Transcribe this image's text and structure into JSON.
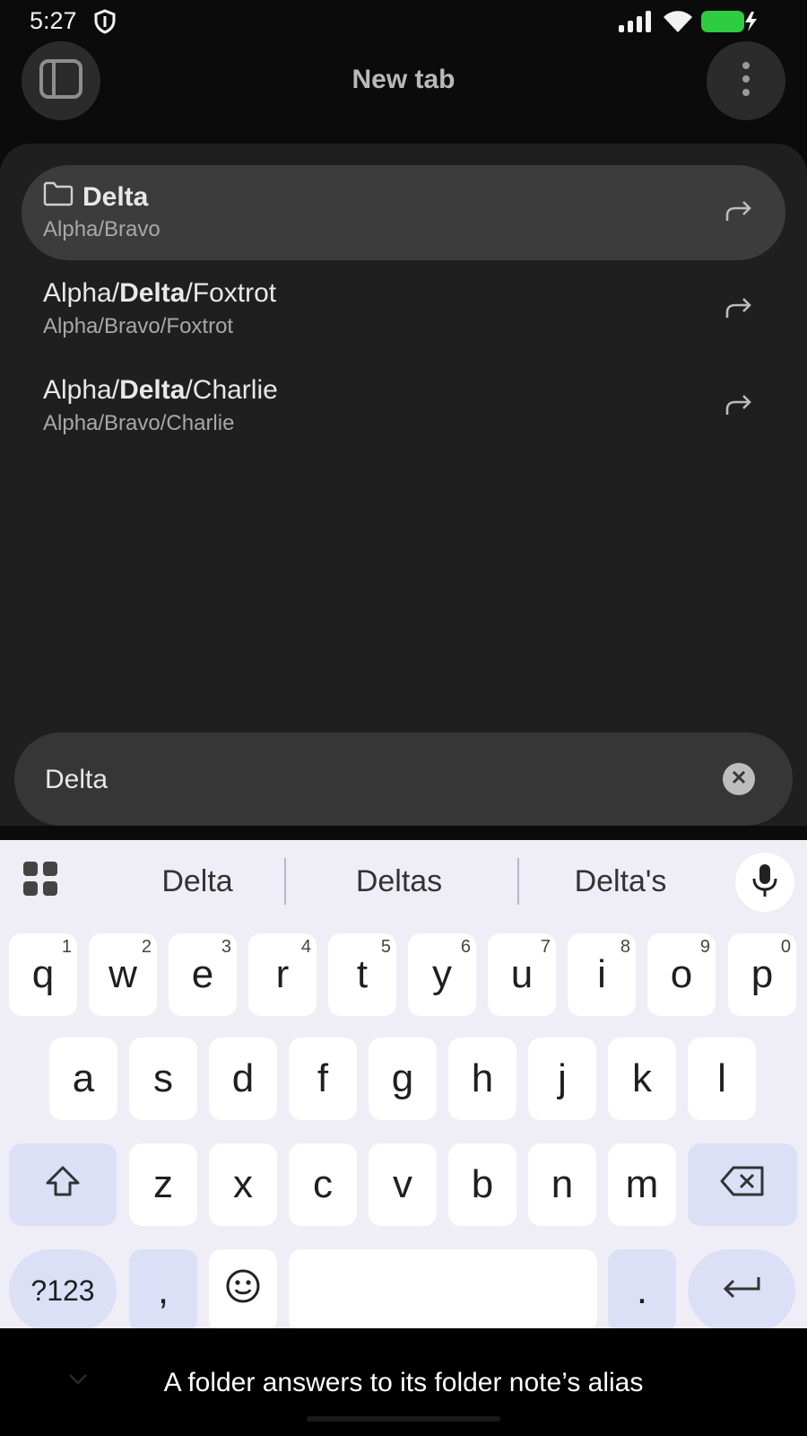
{
  "status_bar": {
    "time": "5:27",
    "icons": [
      "shield-icon",
      "signal-icon",
      "wifi-icon",
      "battery-charging-icon"
    ],
    "battery_color": "#2ecc40"
  },
  "header": {
    "title": "New tab",
    "left_button_icon": "sidebar-toggle-icon",
    "right_button_icon": "more-vert-icon"
  },
  "results": [
    {
      "title_prefix": "",
      "title_match": "Delta",
      "title_suffix": "",
      "subtitle": "Alpha/Bravo",
      "is_folder": true,
      "selected": true
    },
    {
      "title_prefix": "Alpha/",
      "title_match": "Delta",
      "title_suffix": "/Foxtrot",
      "subtitle": "Alpha/Bravo/Foxtrot",
      "is_folder": false,
      "selected": false
    },
    {
      "title_prefix": "Alpha/",
      "title_match": "Delta",
      "title_suffix": "/Charlie",
      "subtitle": "Alpha/Bravo/Charlie",
      "is_folder": false,
      "selected": false
    }
  ],
  "search": {
    "value": "Delta"
  },
  "keyboard": {
    "suggestions": [
      "Delta",
      "Deltas",
      "Delta's"
    ],
    "row1": [
      {
        "key": "q",
        "hint": "1"
      },
      {
        "key": "w",
        "hint": "2"
      },
      {
        "key": "e",
        "hint": "3"
      },
      {
        "key": "r",
        "hint": "4"
      },
      {
        "key": "t",
        "hint": "5"
      },
      {
        "key": "y",
        "hint": "6"
      },
      {
        "key": "u",
        "hint": "7"
      },
      {
        "key": "i",
        "hint": "8"
      },
      {
        "key": "o",
        "hint": "9"
      },
      {
        "key": "p",
        "hint": "0"
      }
    ],
    "row2": [
      "a",
      "s",
      "d",
      "f",
      "g",
      "h",
      "j",
      "k",
      "l"
    ],
    "row3": [
      "z",
      "x",
      "c",
      "v",
      "b",
      "n",
      "m"
    ],
    "symbols_label": "?123",
    "comma_label": ",",
    "period_label": "."
  },
  "caption": "A folder answers to its folder note’s alias"
}
